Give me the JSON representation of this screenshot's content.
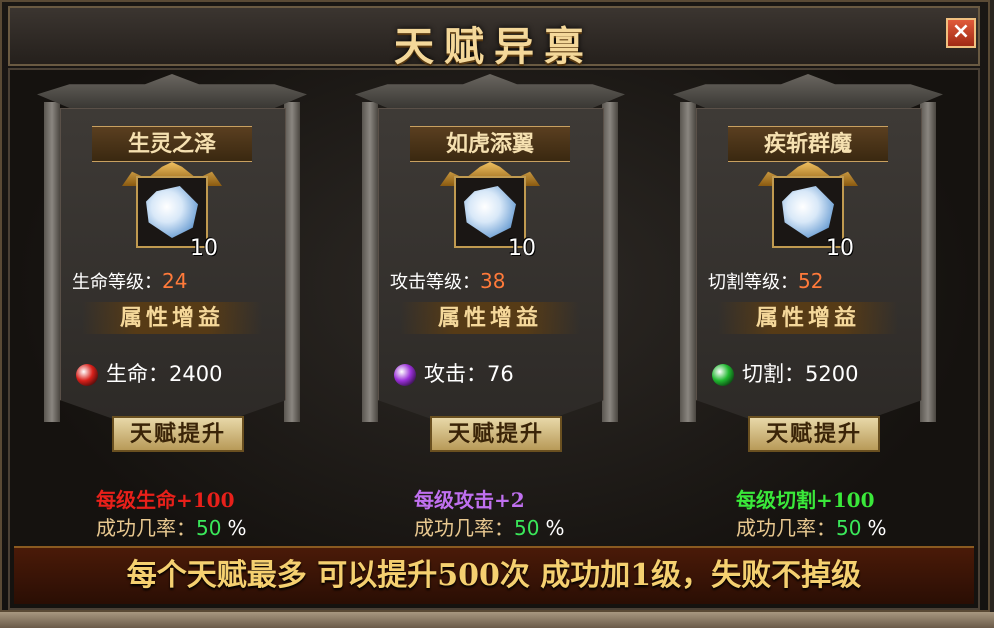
{
  "window": {
    "title": "天赋异禀",
    "close_label": "×"
  },
  "talents": [
    {
      "name": "生灵之泽",
      "item_count": "10",
      "level_label": "生命等级：",
      "level_value": "24",
      "attr_header": "属性增益",
      "stat_label": "生命：",
      "stat_value": "2400",
      "orb_color": "#d8201a",
      "button_label": "天赋提升",
      "per_level": "每级生命+100",
      "per_level_color": "#e8201a",
      "rate_label": "成功几率：",
      "rate_value": "50",
      "rate_unit": "%"
    },
    {
      "name": "如虎添翼",
      "item_count": "10",
      "level_label": "攻击等级：",
      "level_value": "38",
      "attr_header": "属性增益",
      "stat_label": "攻击：",
      "stat_value": "76",
      "orb_color": "#9a30d8",
      "button_label": "天赋提升",
      "per_level": "每级攻击+2",
      "per_level_color": "#c070f0",
      "rate_label": "成功几率：",
      "rate_value": "50",
      "rate_unit": "%"
    },
    {
      "name": "疾斩群魔",
      "item_count": "10",
      "level_label": "切割等级：",
      "level_value": "52",
      "attr_header": "属性增益",
      "stat_label": "切割：",
      "stat_value": "5200",
      "orb_color": "#20b830",
      "button_label": "天赋提升",
      "per_level": "每级切割+100",
      "per_level_color": "#3ae83a",
      "rate_label": "成功几率：",
      "rate_value": "50",
      "rate_unit": "%"
    }
  ],
  "footer": {
    "text": "每个天赋最多 可以提升500次 成功加1级，失败不掉级"
  }
}
